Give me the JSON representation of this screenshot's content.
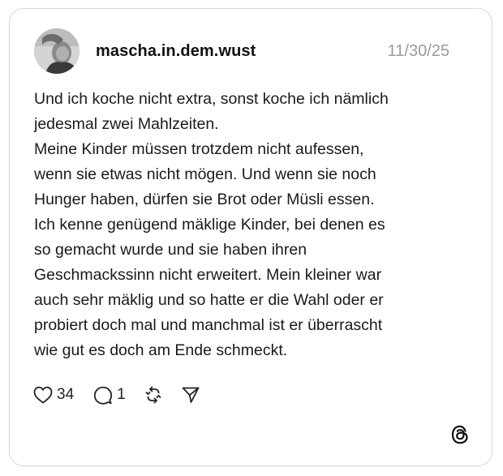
{
  "post": {
    "username": "mascha.in.dem.wust",
    "date": "11/30/25",
    "text_lines": [
      "Und ich koche nicht extra, sonst koche ich nämlich",
      "jedesmal zwei Mahlzeiten.",
      "Meine Kinder müssen trotzdem nicht aufessen,",
      "wenn sie etwas nicht mögen. Und wenn sie noch",
      "Hunger haben, dürfen sie Brot oder Müsli essen.",
      "Ich kenne genügend mäklige Kinder, bei denen es",
      "so gemacht wurde und sie haben ihren",
      "Geschmackssinn nicht erweitert. Mein kleiner war",
      "auch sehr mäklig und so hatte er die Wahl oder er",
      "probiert doch mal und manchmal ist er überrascht",
      "wie gut es doch am Ende schmeckt."
    ]
  },
  "actions": {
    "like_icon": "heart-icon",
    "like_count": "34",
    "reply_icon": "comment-icon",
    "reply_count": "1",
    "repost_icon": "repost-icon",
    "share_icon": "send-icon"
  },
  "branding": {
    "logo_icon": "threads-logo-icon"
  }
}
